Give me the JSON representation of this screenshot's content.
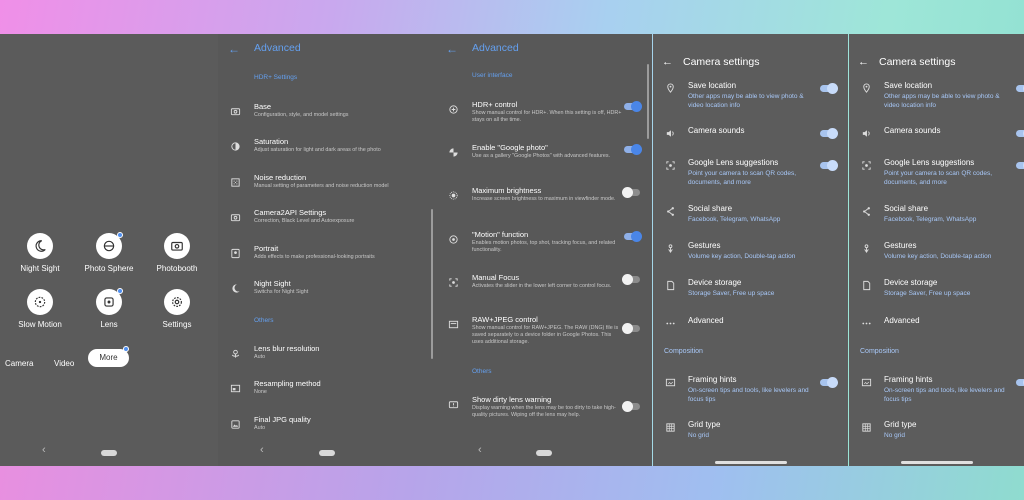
{
  "camera_screen": {
    "modes": [
      {
        "label": "Night Sight",
        "icon": "moon-icon"
      },
      {
        "label": "Photo Sphere",
        "icon": "photo-sphere-icon"
      },
      {
        "label": "Photobooth",
        "icon": "camera-icon"
      },
      {
        "label": "Slow Motion",
        "icon": "slow-motion-icon"
      },
      {
        "label": "Lens",
        "icon": "lens-icon"
      },
      {
        "label": "Settings",
        "icon": "gear-icon"
      }
    ],
    "tabs": {
      "camera": "Camera",
      "video": "Video",
      "more": "More"
    }
  },
  "advanced_left": {
    "title": "Advanced",
    "section_hdr": "HDR+ Settings",
    "section_others": "Others",
    "items": [
      {
        "title": "Base",
        "sub": "Configuration, style, and model settings",
        "icon": "camera-icon"
      },
      {
        "title": "Saturation",
        "sub": "Adjust saturation for light and dark areas of the photo",
        "icon": "contrast-icon"
      },
      {
        "title": "Noise reduction",
        "sub": "Manual setting of parameters and noise reduction model",
        "icon": "noise-icon"
      },
      {
        "title": "Camera2API Settings",
        "sub": "Correction, Black Level and Autoexposure",
        "icon": "camera-icon"
      },
      {
        "title": "Portrait",
        "sub": "Adds effects to make professional-looking portraits",
        "icon": "portrait-icon"
      },
      {
        "title": "Night Sight",
        "sub": "Switchs for Night Sight",
        "icon": "moon-icon"
      },
      {
        "title": "Lens blur resolution",
        "sub": "Auto",
        "icon": "flower-icon"
      },
      {
        "title": "Resampling method",
        "sub": "None",
        "icon": "resample-icon"
      },
      {
        "title": "Final JPG quality",
        "sub": "Auto",
        "icon": "image-icon"
      }
    ]
  },
  "advanced_right": {
    "title": "Advanced",
    "section_ui": "User interface",
    "section_others": "Others",
    "items": [
      {
        "title": "HDR+ control",
        "sub": "Show manual control for HDR+. When this setting is off, HDR+ stays on all the time.",
        "icon": "hdr-icon",
        "on": true
      },
      {
        "title": "Enable \"Google photo\"",
        "sub": "Use as a gallery \"Google Photos\" with advanced features.",
        "icon": "pinwheel-icon",
        "on": true
      },
      {
        "title": "Maximum brightness",
        "sub": "Increase screen brightness to maximum in viewfinder mode.",
        "icon": "brightness-icon",
        "on": false
      },
      {
        "title": "\"Motion\" function",
        "sub": "Enables motion photos, top shot, tracking focus, and related functionality.",
        "icon": "motion-icon",
        "on": true
      },
      {
        "title": "Manual Focus",
        "sub": "Activates the slider in the lower left corner to control focus.",
        "icon": "focus-icon",
        "on": false
      },
      {
        "title": "RAW+JPEG control",
        "sub": "Show manual control for RAW+JPEG. The RAW (DNG) file is saved separately to a device folder in Google Photos. This uses additional storage.",
        "icon": "raw-icon",
        "on": false
      },
      {
        "title": "Show dirty lens warning",
        "sub": "Display warning when the lens may be too dirty to take high-quality pictures. Wiping off the lens may help.",
        "icon": "warning-icon",
        "on": false
      }
    ]
  },
  "camera_settings": {
    "title": "Camera settings",
    "section_composition": "Composition",
    "items": [
      {
        "title": "Save location",
        "sub": "Other apps may be able to view photo & video location info",
        "icon": "location-icon",
        "toggle": true
      },
      {
        "title": "Camera sounds",
        "sub": "",
        "icon": "volume-icon",
        "toggle": true
      },
      {
        "title": "Google Lens suggestions",
        "sub": "Point your camera to scan QR codes, documents, and more",
        "icon": "lens-scan-icon",
        "toggle": true
      },
      {
        "title": "Social share",
        "sub": "Facebook, Telegram, WhatsApp",
        "icon": "share-icon",
        "toggle": false
      },
      {
        "title": "Gestures",
        "sub": "Volume key action, Double-tap action",
        "icon": "gesture-icon",
        "toggle": false
      },
      {
        "title": "Device storage",
        "sub": "Storage Saver, Free up space",
        "icon": "storage-icon",
        "toggle": false
      },
      {
        "title": "Advanced",
        "sub": "",
        "icon": "more-icon",
        "toggle": false
      },
      {
        "title": "Framing hints",
        "sub": "On-screen tips and tools, like levelers and focus tips",
        "icon": "framing-icon",
        "toggle": true
      },
      {
        "title": "Grid type",
        "sub": "No grid",
        "icon": "grid-icon",
        "toggle": false
      }
    ]
  }
}
